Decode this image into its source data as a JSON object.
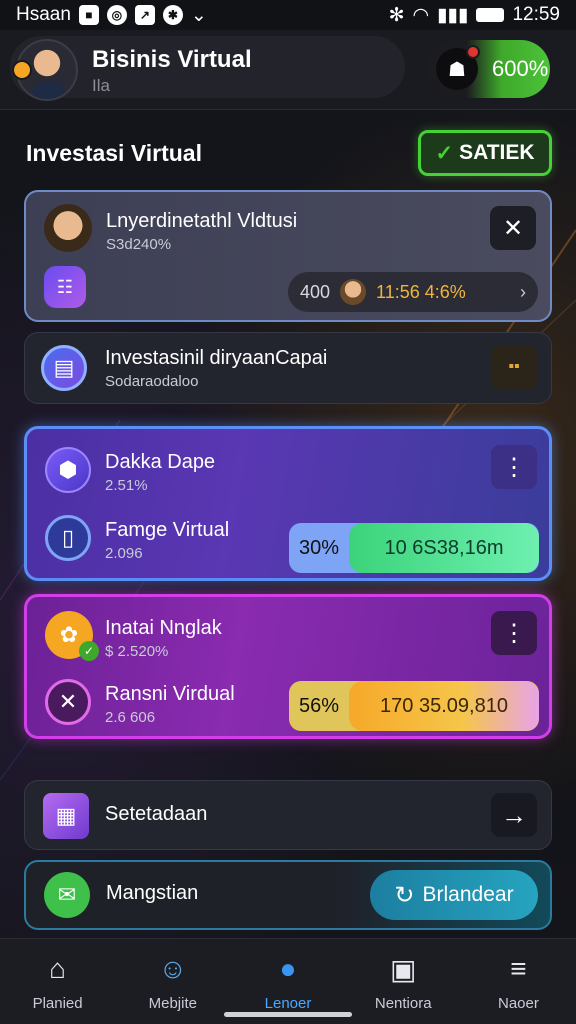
{
  "status": {
    "carrier": "Hsaan",
    "time": "12:59"
  },
  "header": {
    "title": "Bisinis Virtual",
    "subtitle": "Ila",
    "balance": "600%"
  },
  "section": {
    "title": "Investasi Virtual",
    "button_label": "SATIEK"
  },
  "cards": {
    "card1": {
      "title": "Lnyerdinetathl Vldtusi",
      "sub": "S3d240%",
      "pill_a": "400",
      "pill_b": "11:56 4:6%"
    },
    "card2": {
      "title": "Investasinil diryaanCapai",
      "sub": "Sodaraodaloo"
    },
    "card3": {
      "row1_title": "Dakka Dape",
      "row1_sub": "2.51%",
      "row2_title": "Famge Virtual",
      "row2_sub": "2.096",
      "progress_pct": "30%",
      "progress_value": "10 6S38,16m",
      "progress_fraction": 0.3
    },
    "card4": {
      "row1_title": "Inatai Nnglak",
      "row1_sub": "$ 2.520%",
      "row2_title": "Ransni Virdual",
      "row2_sub": "2.6 606",
      "progress_pct": "56%",
      "progress_value": "170 35.09,810",
      "progress_fraction": 0.56
    },
    "card5": {
      "title": "Setetadaan"
    },
    "card6": {
      "title": "Mangstian",
      "button_label": "Brlandear"
    }
  },
  "nav": [
    {
      "label": "Planied",
      "icon": "home-icon"
    },
    {
      "label": "Mebjite",
      "icon": "people-icon"
    },
    {
      "label": "Lenoer",
      "icon": "lock-icon"
    },
    {
      "label": "Nentiora",
      "icon": "wallet-icon"
    },
    {
      "label": "Naoer",
      "icon": "menu-icon"
    }
  ],
  "colors": {
    "accent_green": "#46d136",
    "accent_blue": "#5b8ef7",
    "accent_purple": "#d23ee8",
    "nav_active": "#3a95f0"
  }
}
